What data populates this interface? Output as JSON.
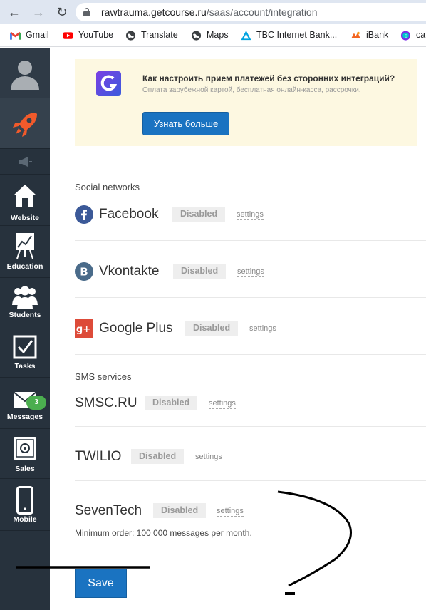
{
  "browser": {
    "url_host": "rawtrauma.getcourse.ru",
    "url_path": "/saas/account/integration",
    "bookmarks": [
      {
        "label": "Gmail",
        "icon": "gmail-icon"
      },
      {
        "label": "YouTube",
        "icon": "youtube-icon"
      },
      {
        "label": "Translate",
        "icon": "globe-icon"
      },
      {
        "label": "Maps",
        "icon": "globe-icon"
      },
      {
        "label": "TBC Internet Bank...",
        "icon": "tbc-icon"
      },
      {
        "label": "iBank",
        "icon": "ibank-icon"
      },
      {
        "label": "ca",
        "icon": "canva-icon"
      }
    ]
  },
  "sidebar": {
    "items": [
      {
        "label": "",
        "icon": "avatar-icon"
      },
      {
        "label": "",
        "icon": "rocket-icon"
      },
      {
        "label": "",
        "icon": "megaphone-icon"
      },
      {
        "label": "Website",
        "icon": "house-icon"
      },
      {
        "label": "Education",
        "icon": "chart-board-icon"
      },
      {
        "label": "Students",
        "icon": "people-icon"
      },
      {
        "label": "Tasks",
        "icon": "checkbox-icon"
      },
      {
        "label": "Messages",
        "icon": "envelope-icon",
        "badge": "3"
      },
      {
        "label": "Sales",
        "icon": "safe-icon"
      },
      {
        "label": "Mobile",
        "icon": "phone-icon"
      }
    ]
  },
  "promo": {
    "title": "Как настроить прием платежей без сторонних интеграций?",
    "subtitle": "Оплата зарубежной картой, бесплатная онлайн-касса, рассрочки.",
    "button": "Узнать больше"
  },
  "social": {
    "title": "Social networks",
    "items": [
      {
        "name": "Facebook",
        "status": "Disabled",
        "settings": "settings"
      },
      {
        "name": "Vkontakte",
        "status": "Disabled",
        "settings": "settings"
      },
      {
        "name": "Google Plus",
        "status": "Disabled",
        "settings": "settings"
      }
    ]
  },
  "sms": {
    "title": "SMS services",
    "items": [
      {
        "name": "SMSC.RU",
        "status": "Disabled",
        "settings": "settings"
      },
      {
        "name": "TWILIO",
        "status": "Disabled",
        "settings": "settings"
      },
      {
        "name": "SevenTech",
        "status": "Disabled",
        "settings": "settings",
        "note": "Minimum order: 100 000 messages per month."
      }
    ]
  },
  "save_label": "Save",
  "colors": {
    "primary": "#1a73c1",
    "sidebar": "#27323d",
    "promo_bg": "#fdf8e1",
    "facebook": "#3b5998",
    "vk": "#4a76a8",
    "gplus": "#dd4b39"
  }
}
